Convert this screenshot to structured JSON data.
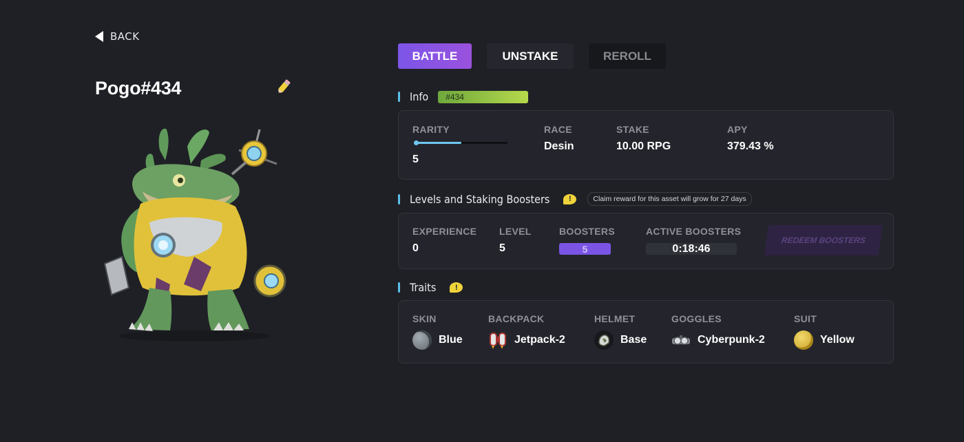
{
  "nav": {
    "back_label": "BACK"
  },
  "asset": {
    "name": "Pogo#434"
  },
  "actions": {
    "battle": "BATTLE",
    "unstake": "UNSTAKE",
    "reroll": "REROLL"
  },
  "info": {
    "title": "Info",
    "tag": "#434",
    "rarity_label": "RARITY",
    "rarity_value": "5",
    "rarity_fraction": 0.5,
    "race_label": "RACE",
    "race_value": "Desin",
    "stake_label": "STAKE",
    "stake_value": "10.00 RPG",
    "apy_label": "APY",
    "apy_value": "379.43 %"
  },
  "levels": {
    "title": "Levels and Staking Boosters",
    "hint": "Claim reward for this asset will grow for 27 days",
    "experience_label": "EXPERIENCE",
    "experience_value": "0",
    "level_label": "LEVEL",
    "level_value": "5",
    "boosters_label": "BOOSTERS",
    "boosters_value": "5",
    "active_label": "ACTIVE BOOSTERS",
    "active_value": "0:18:46",
    "redeem_label": "REDEEM BOOSTERS"
  },
  "traits": {
    "title": "Traits",
    "items": [
      {
        "label": "SKIN",
        "value": "Blue",
        "icon": "skin-icon"
      },
      {
        "label": "BACKPACK",
        "value": "Jetpack-2",
        "icon": "jetpack-icon"
      },
      {
        "label": "HELMET",
        "value": "Base",
        "icon": "helmet-icon"
      },
      {
        "label": "GOGGLES",
        "value": "Cyberpunk-2",
        "icon": "goggles-icon"
      },
      {
        "label": "SUIT",
        "value": "Yellow",
        "icon": "suit-icon"
      }
    ]
  },
  "colors": {
    "accent": "#58c0ea",
    "battle": "#8352e2",
    "booster": "#7b54e6",
    "tag_green": "#9ccb46"
  }
}
